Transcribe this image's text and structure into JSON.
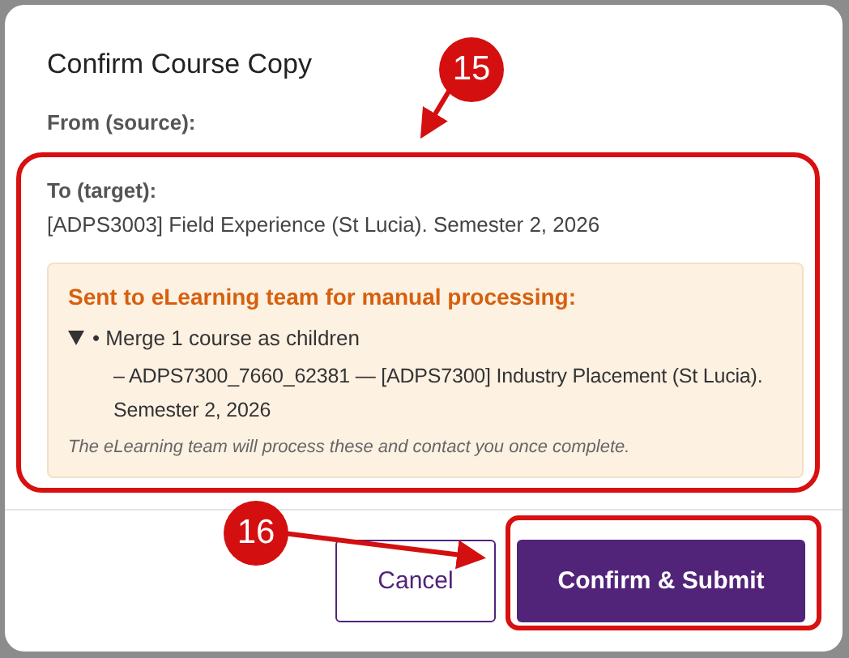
{
  "dialog": {
    "title": "Confirm Course Copy",
    "from_label": "From (source):",
    "to_label": "To (target):",
    "target_course": "[ADPS3003] Field Experience (St Lucia). Semester 2, 2026",
    "notice": {
      "heading": "Sent to eLearning team for manual processing:",
      "items": [
        {
          "label": "• Merge 1 course as children",
          "expanded": true,
          "children": [
            {
              "label": "– ADPS7300_7660_62381 — [ADPS7300] Industry Placement (St Lucia). Semester 2, 2026"
            }
          ]
        }
      ],
      "note": "The eLearning team will process these and contact you once complete."
    },
    "buttons": [
      {
        "label": "Cancel",
        "kind": "secondary"
      },
      {
        "label": "Confirm & Submit",
        "kind": "primary"
      }
    ]
  },
  "callouts": [
    {
      "number": "15"
    },
    {
      "number": "16"
    }
  ]
}
